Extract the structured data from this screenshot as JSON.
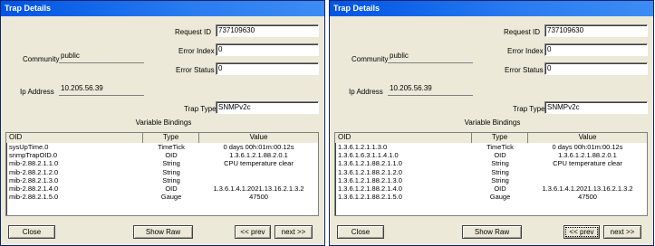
{
  "windows": [
    {
      "title": "Trap Details",
      "request_id_label": "Request ID",
      "request_id": "737109630",
      "error_index_label": "Error Index",
      "error_index": "0",
      "error_status_label": "Error Status",
      "error_status": "0",
      "community_label": "Community",
      "community": "public",
      "ip_label": "Ip Address",
      "ip": "10.205.56.39",
      "trap_type_label": "Trap Type",
      "trap_type": "SNMPv2c",
      "bindings_title": "Variable Bindings",
      "columns": [
        "OID",
        "Type",
        "Value"
      ],
      "rows": [
        {
          "oid": "sysUpTime.0",
          "type": "TimeTick",
          "value": "0 days 00h:01m:00.12s"
        },
        {
          "oid": "snmpTrapOID.0",
          "type": "OID",
          "value": "1.3.6.1.2.1.88.2.0.1"
        },
        {
          "oid": "mib-2.88.2.1.1.0",
          "type": "String",
          "value": "CPU temperature clear"
        },
        {
          "oid": "mib-2.88.2.1.2.0",
          "type": "String",
          "value": ""
        },
        {
          "oid": "mib-2.88.2.1.3.0",
          "type": "String",
          "value": ""
        },
        {
          "oid": "mib-2.88.2.1.4.0",
          "type": "OID",
          "value": "1.3.6.1.4.1.2021.13.16.2.1.3.2"
        },
        {
          "oid": "mib-2.88.2.1.5.0",
          "type": "Gauge",
          "value": "47500"
        }
      ],
      "buttons": {
        "close": "Close",
        "show_raw": "Show Raw",
        "prev": "<< prev",
        "next": "next >>"
      }
    },
    {
      "title": "Trap Details",
      "request_id_label": "Request ID",
      "request_id": "737109630",
      "error_index_label": "Error Index",
      "error_index": "0",
      "error_status_label": "Error Status",
      "error_status": "0",
      "community_label": "Community",
      "community": "public",
      "ip_label": "Ip Address",
      "ip": "10.205.56.39",
      "trap_type_label": "Trap Type",
      "trap_type": "SNMPv2c",
      "bindings_title": "Variable Bindings",
      "columns": [
        "OID",
        "Type",
        "Value"
      ],
      "rows": [
        {
          "oid": "1.3.6.1.2.1.1.3.0",
          "type": "TimeTick",
          "value": "0 days 00h:01m:00.12s"
        },
        {
          "oid": "1.3.6.1.6.3.1.1.4.1.0",
          "type": "OID",
          "value": "1.3.6.1.2.1.88.2.0.1"
        },
        {
          "oid": "1.3.6.1.2.1.88.2.1.1.0",
          "type": "String",
          "value": "CPU temperature clear"
        },
        {
          "oid": "1.3.6.1.2.1.88.2.1.2.0",
          "type": "String",
          "value": ""
        },
        {
          "oid": "1.3.6.1.2.1.88.2.1.3.0",
          "type": "String",
          "value": ""
        },
        {
          "oid": "1.3.6.1.2.1.88.2.1.4.0",
          "type": "OID",
          "value": "1.3.6.1.4.1.2021.13.16.2.1.3.2"
        },
        {
          "oid": "1.3.6.1.2.1.88.2.1.5.0",
          "type": "Gauge",
          "value": "47500"
        }
      ],
      "buttons": {
        "close": "Close",
        "show_raw": "Show Raw",
        "prev": "<< prev",
        "next": "next >>"
      }
    }
  ]
}
